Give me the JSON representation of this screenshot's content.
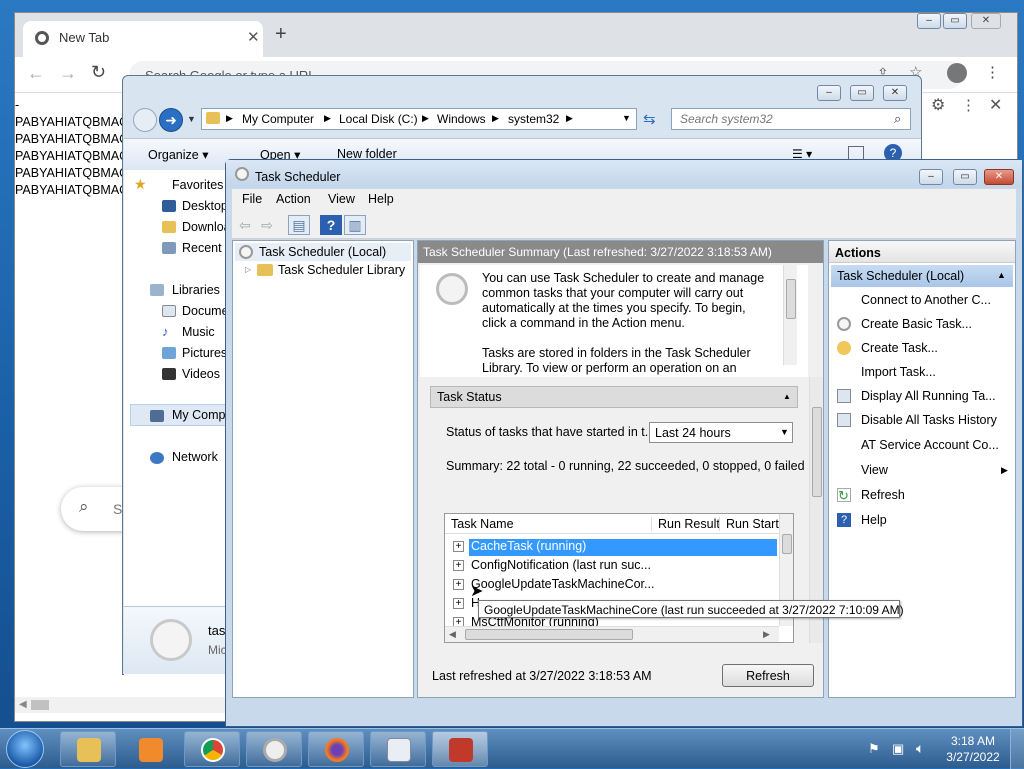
{
  "chrome": {
    "tab_title": "New Tab",
    "omnibox_placeholder": "Search Google or type a URL",
    "page_text": [
      "-",
      "PABYAHIATQBMAC",
      "PABYAHIATQBMAC",
      "PABYAHIATQBMAC",
      "PABYAHIATQBMAC",
      "PABYAHIATQBMAC"
    ],
    "search_hint": "S"
  },
  "explorer": {
    "address": [
      "My Computer",
      "Local Disk (C:)",
      "Windows",
      "system32"
    ],
    "search_placeholder": "Search system32",
    "toolbar": {
      "organize": "Organize",
      "open": "Open",
      "new_folder": "New folder"
    },
    "nav": {
      "favorites": "Favorites",
      "desktop": "Desktop",
      "downloads": "Downloads",
      "recent": "Recent Places",
      "libraries": "Libraries",
      "documents": "Documents",
      "music": "Music",
      "pictures": "Pictures",
      "videos": "Videos",
      "computer": "My Computer",
      "network": "Network"
    },
    "details": {
      "name": "tas",
      "sub": "Mic"
    }
  },
  "task_scheduler": {
    "title": "Task Scheduler",
    "menu": [
      "File",
      "Action",
      "View",
      "Help"
    ],
    "tree": {
      "root": "Task Scheduler (Local)",
      "library": "Task Scheduler Library"
    },
    "center": {
      "header": "Task Scheduler Summary (Last refreshed: 3/27/2022 3:18:53 AM)",
      "intro": [
        "You can use Task Scheduler to create and manage",
        "common tasks that your computer will carry out",
        "automatically at the times you specify. To begin,",
        "click a command in the Action menu."
      ],
      "intro2": [
        "Tasks are stored in folders in the Task Scheduler",
        "Library. To view or perform an operation on an"
      ],
      "status_title": "Task Status",
      "status_label": "Status of tasks that have started in t...",
      "status_select": "Last 24 hours",
      "summary": "Summary: 22 total - 0 running, 22 succeeded, 0 stopped, 0 failed",
      "columns": [
        "Task Name",
        "Run Result",
        "Run Start"
      ],
      "rows": [
        "CacheTask (running)",
        "ConfigNotification (last run suc...",
        "GoogleUpdateTaskMachineCor...",
        "H",
        "MsCtfMonitor (running)"
      ],
      "tooltip": "GoogleUpdateTaskMachineCore (last run succeeded at 3/27/2022 7:10:09 AM)",
      "footer": "Last refreshed at 3/27/2022 3:18:53 AM",
      "refresh_button": "Refresh"
    },
    "actions": {
      "title": "Actions",
      "section": "Task Scheduler (Local)",
      "items": [
        "Connect to Another C...",
        "Create Basic Task...",
        "Create Task...",
        "Import Task...",
        "Display All Running Ta...",
        "Disable All Tasks History",
        "AT Service Account Co...",
        "View",
        "Refresh",
        "Help"
      ]
    }
  },
  "taskbar": {
    "time": "3:18 AM",
    "date": "3/27/2022"
  }
}
